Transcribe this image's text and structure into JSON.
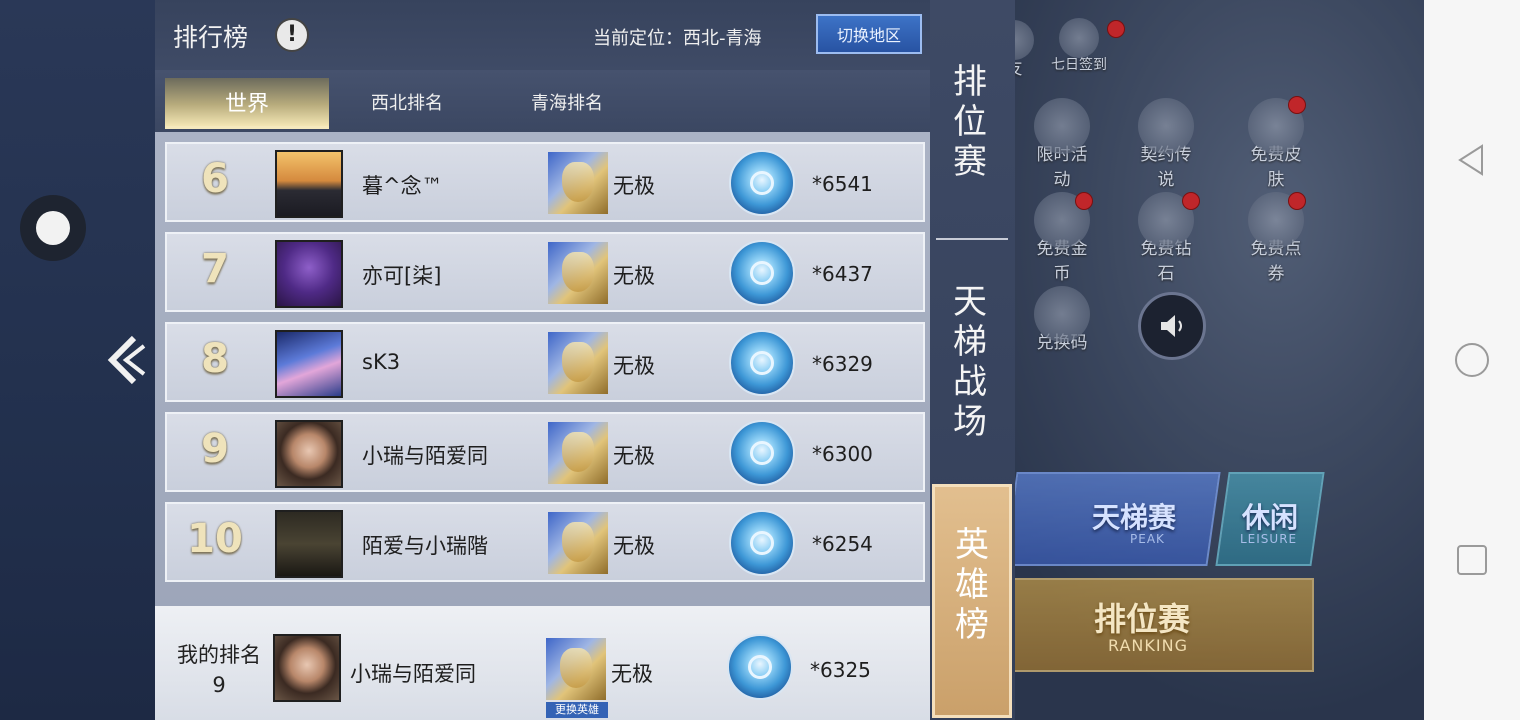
{
  "panel": {
    "title": "排行榜",
    "info_glyph": "!",
    "location_text": "当前定位：西北-青海",
    "switch_button": "切换地区"
  },
  "tabs": [
    {
      "label": "世界",
      "active": true
    },
    {
      "label": "西北排名",
      "active": false
    },
    {
      "label": "青海排名",
      "active": false
    }
  ],
  "rows": [
    {
      "rank": "6",
      "name": "暮^念™",
      "hero": "无极",
      "score": "*6541"
    },
    {
      "rank": "7",
      "name": "亦可[柒]",
      "hero": "无极",
      "score": "*6437"
    },
    {
      "rank": "8",
      "name": "sK3",
      "hero": "无极",
      "score": "*6329"
    },
    {
      "rank": "9",
      "name": "小瑞与陌爱同",
      "hero": "无极",
      "score": "*6300"
    },
    {
      "rank": "10",
      "name": "陌爱与小瑞階",
      "hero": "无极",
      "score": "*6254"
    }
  ],
  "my_rank": {
    "label": "我的排名",
    "rank": "9",
    "name": "小瑞与陌爱同",
    "hero": "无极",
    "score": "*6325",
    "change_hero": "更换英雄"
  },
  "side_tabs": [
    {
      "label": "排\n位\n赛",
      "active": false
    },
    {
      "label": "天\n梯\n战\n场",
      "active": false
    },
    {
      "label": "英\n雄\n榜",
      "active": true
    }
  ],
  "game_bg": {
    "icons": [
      "七日签到",
      "限时活动",
      "契约传说",
      "免费皮肤",
      "免费金币",
      "免费钻石",
      "免费点券",
      "兑换码"
    ],
    "peak_label": "天梯赛",
    "peak_sub": "PEAK",
    "leisure_label": "休闲",
    "leisure_sub": "LEISURE",
    "ranking_label": "排位赛",
    "ranking_sub": "RANKING",
    "friend_fragment": "友"
  },
  "colors": {
    "panel_header": "#37435d",
    "accent_gold": "#efe3bb",
    "switch_blue": "#2853a3"
  }
}
